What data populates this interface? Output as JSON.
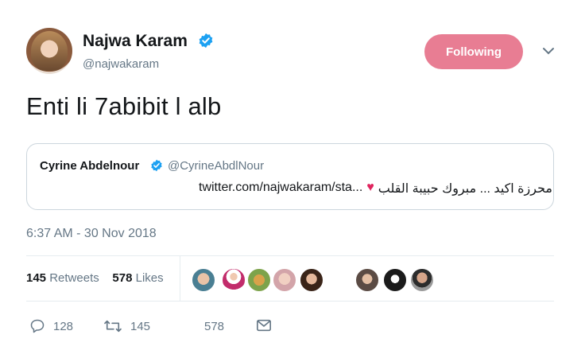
{
  "tweet": {
    "author_name": "Najwa Karam",
    "author_handle": "@najwakaram",
    "text": "Enti li 7abibit l alb",
    "timestamp": "6:37 AM - 30 Nov 2018",
    "follow_label": "Following"
  },
  "quoted_tweet": {
    "author_name": "Cyrine Abdelnour",
    "author_handle": "@CyrineAbdlNour",
    "text_arabic": "محرزة اكيد ... مبروك حبيبة القلب",
    "link": "twitter.com/najwakaram/sta...",
    "heart": "♥"
  },
  "stats": {
    "retweets_count": "145",
    "retweets_label": "Retweets",
    "likes_count": "578",
    "likes_label": "Likes"
  },
  "actions": {
    "replies": "128",
    "retweets": "145",
    "likes": "578"
  },
  "colors": {
    "follow_button": "#e87d93",
    "verified": "#1da1f2",
    "muted_text": "#657786",
    "heart": "#e0245e"
  }
}
